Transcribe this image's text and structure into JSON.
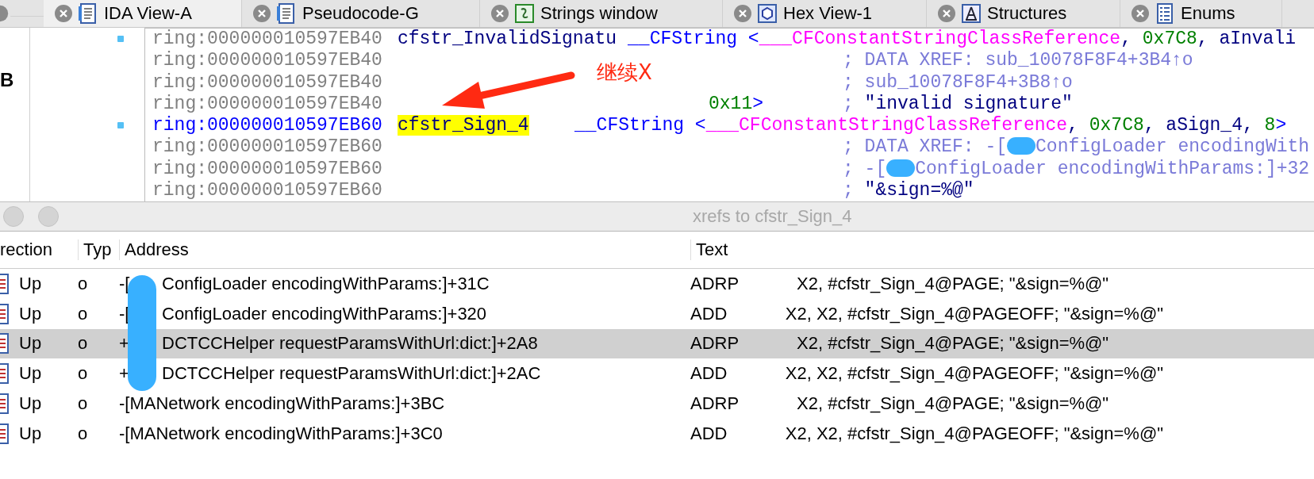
{
  "left_panel": {
    "text": "B"
  },
  "tabs": [
    {
      "label": "IDA View-A",
      "kind": "listing",
      "selected": true
    },
    {
      "label": "Pseudocode-G",
      "kind": "listing",
      "selected": false
    },
    {
      "label": "Strings window",
      "kind": "strings",
      "selected": false
    },
    {
      "label": "Hex View-1",
      "kind": "hex",
      "selected": false
    },
    {
      "label": "Structures",
      "kind": "struct",
      "selected": false
    },
    {
      "label": "Enums",
      "kind": "enum",
      "selected": false
    }
  ],
  "listing": [
    {
      "address": "ring:000000010597EB40",
      "selected": false,
      "marked": true,
      "label": "cfstr_InvalidSignatu",
      "operand": [
        {
          "kind": "type",
          "text": "__CFString <"
        },
        {
          "kind": "symbol",
          "text": "___CFConstantStringClassReference"
        },
        {
          "kind": "plain",
          "text": ", "
        },
        {
          "kind": "number",
          "text": "0x7C8"
        },
        {
          "kind": "plain",
          "text": ", aInvali"
        }
      ]
    },
    {
      "address": "ring:000000010597EB40",
      "selected": false,
      "marked": false,
      "comment": [
        {
          "kind": "xref",
          "text": "; DATA XREF: sub_10078F8F4+3B4↑o"
        }
      ]
    },
    {
      "address": "ring:000000010597EB40",
      "selected": false,
      "marked": false,
      "comment": [
        {
          "kind": "xref",
          "text": "; sub_10078F8F4+3B8↑o"
        }
      ]
    },
    {
      "address": "ring:000000010597EB40",
      "selected": false,
      "marked": false,
      "operand": [
        {
          "kind": "number",
          "text": "0x11"
        },
        {
          "kind": "type",
          "text": ">"
        }
      ],
      "comment": [
        {
          "kind": "xref",
          "text": "; "
        },
        {
          "kind": "string",
          "text": "\"invalid signature\""
        }
      ]
    },
    {
      "address": "ring:000000010597EB60",
      "selected": true,
      "marked": true,
      "label": "cfstr_Sign_4",
      "operand": [
        {
          "kind": "type",
          "text": "__CFString <"
        },
        {
          "kind": "symbol",
          "text": "___CFConstantStringClassReference"
        },
        {
          "kind": "plain",
          "text": ", "
        },
        {
          "kind": "number",
          "text": "0x7C8"
        },
        {
          "kind": "plain",
          "text": ", aSign_4, "
        },
        {
          "kind": "number",
          "text": "8"
        },
        {
          "kind": "type",
          "text": ">"
        }
      ]
    },
    {
      "address": "ring:000000010597EB60",
      "selected": false,
      "marked": false,
      "comment": [
        {
          "kind": "xref",
          "text": "; DATA XREF: -["
        },
        {
          "kind": "redaction"
        },
        {
          "kind": "xref",
          "text": "ConfigLoader encodingWith"
        }
      ]
    },
    {
      "address": "ring:000000010597EB60",
      "selected": false,
      "marked": false,
      "comment": [
        {
          "kind": "xref",
          "text": "; -["
        },
        {
          "kind": "redaction"
        },
        {
          "kind": "xref",
          "text": "ConfigLoader encodingWithParams:]+32"
        }
      ]
    },
    {
      "address": "ring:000000010597EB60",
      "selected": false,
      "marked": false,
      "comment": [
        {
          "kind": "xref",
          "text": "; "
        },
        {
          "kind": "string",
          "text": "\"&sign=%@\""
        }
      ]
    }
  ],
  "annotation": {
    "text": "继续X"
  },
  "dialog": {
    "title": "xrefs to cfstr_Sign_4",
    "columns": [
      "rection",
      "Typ",
      "Address",
      "Text"
    ],
    "rows": [
      {
        "direction": "Up",
        "type": "o",
        "address_prefix": "-[",
        "address": "ConfigLoader encodingWithParams:]+31C",
        "text": "ADRP            X2, #cfstr_Sign_4@PAGE; \"&sign=%@\"",
        "selected": false
      },
      {
        "direction": "Up",
        "type": "o",
        "address_prefix": "-[",
        "address": "ConfigLoader encodingWithParams:]+320",
        "text": "ADD            X2, X2, #cfstr_Sign_4@PAGEOFF; \"&sign=%@\"",
        "selected": false
      },
      {
        "direction": "Up",
        "type": "o",
        "address_prefix": "+",
        "address": "DCTCCHelper requestParamsWithUrl:dict:]+2A8",
        "text": "ADRP            X2, #cfstr_Sign_4@PAGE; \"&sign=%@\"",
        "selected": true
      },
      {
        "direction": "Up",
        "type": "o",
        "address_prefix": "+",
        "address": "DCTCCHelper requestParamsWithUrl:dict:]+2AC",
        "text": "ADD            X2, X2, #cfstr_Sign_4@PAGEOFF; \"&sign=%@\"",
        "selected": false
      },
      {
        "direction": "Up",
        "type": "o",
        "address": "-[MANetwork encodingWithParams:]+3BC",
        "text": "ADRP            X2, #cfstr_Sign_4@PAGE; \"&sign=%@\"",
        "selected": false
      },
      {
        "direction": "Up",
        "type": "o",
        "address": "-[MANetwork encodingWithParams:]+3C0",
        "text": "ADD            X2, X2, #cfstr_Sign_4@PAGEOFF; \"&sign=%@\"",
        "selected": false
      }
    ]
  }
}
